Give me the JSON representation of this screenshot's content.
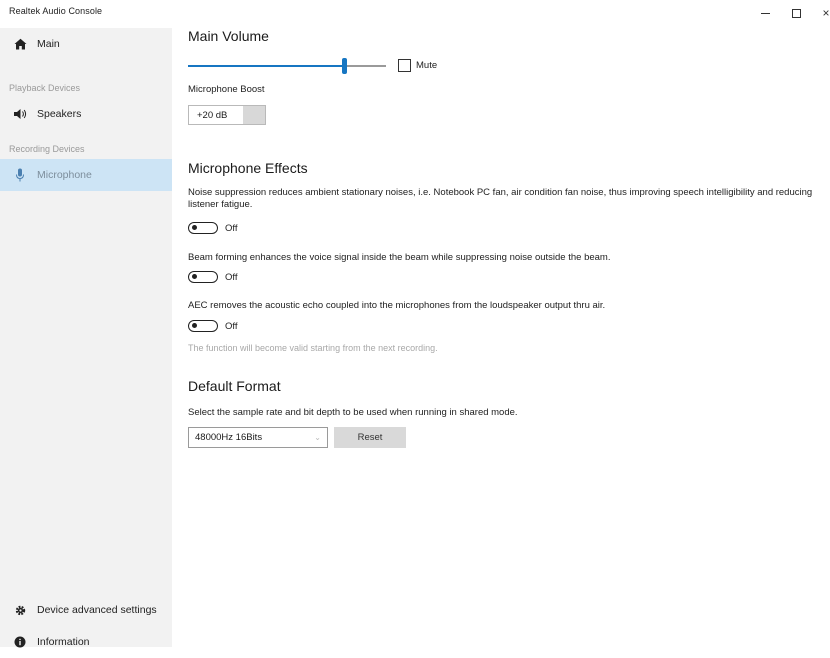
{
  "window": {
    "title": "Realtek Audio Console",
    "minimize_label": "–",
    "maximize_label": "",
    "close_label": "×"
  },
  "sidebar": {
    "main_label": "Main",
    "playback_header": "Playback Devices",
    "speakers_label": "Speakers",
    "recording_header": "Recording Devices",
    "microphone_label": "Microphone",
    "advanced_label": "Device advanced settings",
    "info_label": "Information",
    "selected_bg": "#cde4f5"
  },
  "main_volume": {
    "title": "Main Volume",
    "level": 0.79,
    "mute_label": "Mute",
    "muted": false,
    "accent": "#1776c2"
  },
  "boost": {
    "label": "Microphone Boost",
    "value": "+20 dB"
  },
  "effects": {
    "title": "Microphone Effects",
    "noise_desc": "Noise suppression reduces ambient stationary noises, i.e. Notebook PC fan, air condition fan noise, thus improving speech intelligibility and reducing listener fatigue.",
    "noise_state": "Off",
    "beam_desc": "Beam forming enhances the voice signal inside the beam while suppressing noise outside the beam.",
    "beam_state": "Off",
    "aec_desc": "AEC removes the acoustic echo coupled into the microphones from the loudspeaker output thru air.",
    "aec_state": "Off",
    "note": "The function will become valid starting from the next recording."
  },
  "format": {
    "title": "Default Format",
    "desc": "Select the sample rate and bit depth to be used when running in shared mode.",
    "selected": "48000Hz 16Bits",
    "reset_label": "Reset"
  }
}
